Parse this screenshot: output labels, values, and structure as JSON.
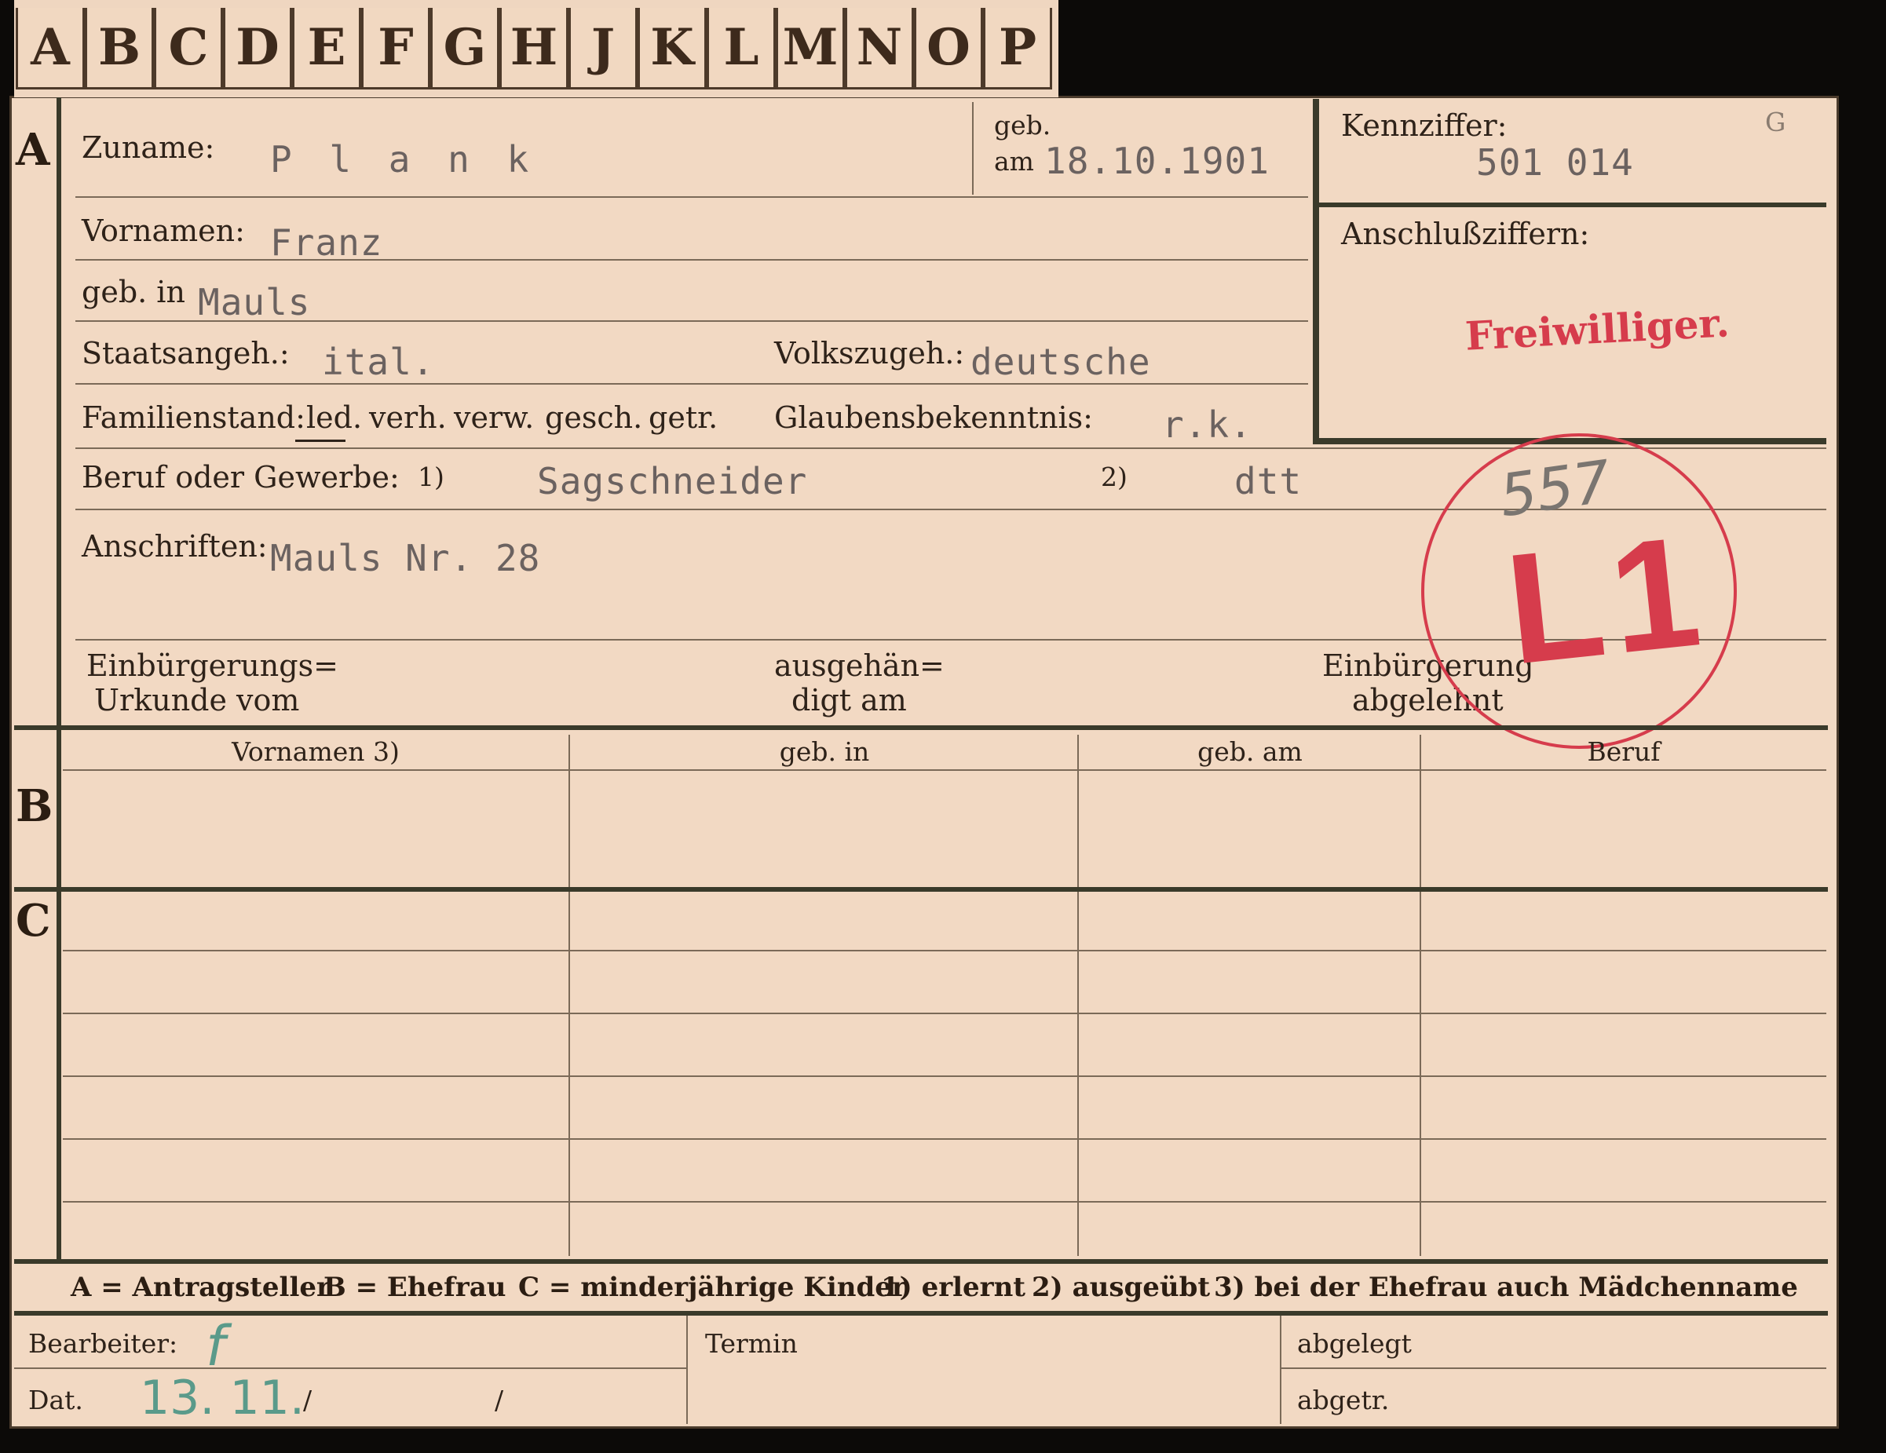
{
  "alphabet_tabs": [
    "A",
    "B",
    "C",
    "D",
    "E",
    "F",
    "G",
    "H",
    "J",
    "K",
    "L",
    "M",
    "N",
    "O",
    "P"
  ],
  "sections": {
    "a": "A",
    "b": "B",
    "c": "C"
  },
  "applicant": {
    "surname_label": "Zuname:",
    "surname_value": "P l a n k",
    "born_label": "geb.",
    "born_on_label": "am",
    "birth_date": "18.10.1901",
    "given_names_label": "Vornamen:",
    "given_names_value": "Franz",
    "birthplace_label": "geb. in",
    "birthplace_value": "Mauls",
    "citizenship_label": "Staatsangeh.:",
    "citizenship_value": "ital.",
    "ethnicity_label": "Volkszugeh.:",
    "ethnicity_value": "deutsche",
    "marital_label": "Familienstand:",
    "marital_options": [
      "led.",
      "verh.",
      "verw.",
      "gesch.",
      "getr."
    ],
    "religion_label": "Glaubensbekenntnis:",
    "religion_value": "r.k.",
    "occupation_label": "Beruf oder Gewerbe:",
    "occupation_mark1": "1)",
    "occupation_value1": "Sagschneider",
    "occupation_mark2": "2)",
    "occupation_value2": "dtt",
    "address_label": "Anschriften:",
    "address_value": "Mauls Nr. 28",
    "naturalization_cert_label_1": "Einbürgerungs=",
    "naturalization_cert_label_2": "Urkunde vom",
    "handed_label_1": "ausgehän=",
    "handed_label_2": "digt am",
    "refused_label_1": "Einbürgerung",
    "refused_label_2": "abgelehnt"
  },
  "id_box": {
    "label": "Kennziffer:",
    "letter": "G",
    "value": "501 014",
    "connection_label": "Anschlußziffern:",
    "stamp_text": "Freiwilliger."
  },
  "round_stamp": {
    "number": "557",
    "code": "L1"
  },
  "table_headers": [
    "Vornamen 3)",
    "geb. in",
    "geb. am",
    "Beruf"
  ],
  "legend": {
    "a": "A = Antragsteller",
    "b": "B = Ehefrau",
    "c": "C = minderjährige Kinder",
    "n1": "1) erlernt",
    "n2": "2) ausgeübt",
    "n3": "3) bei der Ehefrau auch Mädchenname"
  },
  "footer": {
    "processor_label": "Bearbeiter:",
    "processor_value": "f",
    "date_label": "Dat.",
    "date_value": "13. 11.",
    "slash1": "/",
    "slash2": "/",
    "deadline_label": "Termin",
    "filed_label": "abgelegt",
    "filed2_label": "abgetr."
  },
  "colors": {
    "paper": "#f2d9c3",
    "ink": "#2e2219",
    "stamp_red": "#d63c4c",
    "typewriter": "#6b6260"
  }
}
